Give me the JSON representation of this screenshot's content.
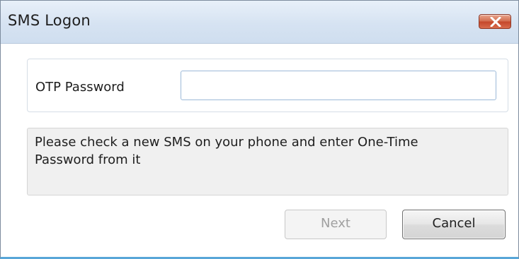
{
  "window": {
    "title": "SMS Logon",
    "close_icon": "close-icon"
  },
  "otp": {
    "label": "OTP Password",
    "value": "",
    "placeholder": ""
  },
  "message": {
    "text": "Please check a new SMS on your phone and enter One-Time Password from it"
  },
  "buttons": {
    "next_label": "Next",
    "next_enabled": false,
    "cancel_label": "Cancel"
  },
  "colors": {
    "titlebar": "#d6e3f2",
    "close_button": "#c4462a",
    "window_accent": "#58a6d8",
    "disabled_text": "#a0a0a0"
  }
}
